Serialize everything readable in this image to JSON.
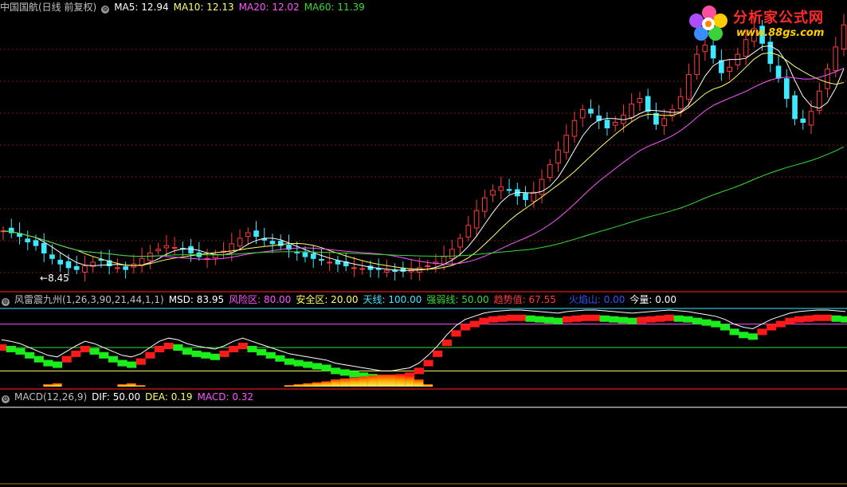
{
  "colors": {
    "bg": "#000000",
    "up": "#ff3b3b",
    "down": "#3ee8ff",
    "ma5": "#ffffff",
    "ma10": "#ffff66",
    "ma20": "#ff55ff",
    "ma60": "#33dd33",
    "grid": "#7a1a1a"
  },
  "main": {
    "title": "中国国航(日线 前复权)",
    "ma5": "MA5: 12.94",
    "ma10": "MA10: 12.13",
    "ma20": "MA20: 12.02",
    "ma60": "MA60: 11.39",
    "low_label": "8.45"
  },
  "ind": {
    "title": "风雷震九州(1,26,3,90,21,44,1,1)",
    "msd": "MSD: 83.95",
    "risk": "风险区: 80.00",
    "safe": "安全区: 20.00",
    "sky": "天线: 100.00",
    "strong": "强弱线: 50.00",
    "trend": "趋势值: 67.55",
    "volcano": "火焰山: 0.00",
    "today": "今量: 0.00"
  },
  "macd": {
    "title": "MACD(12,26,9)",
    "dif": "DIF: 50.00",
    "dea": "DEA: 0.19",
    "macd": "MACD: 0.32"
  },
  "logo": {
    "text": "分析家公式网",
    "url": "www.88gs.com"
  },
  "price_series": {
    "close": [
      11.0,
      10.9,
      10.7,
      10.4,
      10.2,
      9.8,
      9.5,
      9.2,
      9.0,
      8.9,
      9.1,
      9.3,
      9.4,
      9.1,
      9.0,
      8.9,
      9.2,
      9.5,
      9.8,
      10.0,
      10.2,
      10.1,
      10.0,
      9.8,
      9.6,
      9.5,
      9.7,
      9.9,
      10.3,
      10.6,
      10.9,
      10.7,
      10.5,
      10.3,
      10.2,
      10.0,
      9.8,
      9.6,
      9.5,
      9.4,
      9.3,
      9.2,
      9.1,
      9.0,
      8.95,
      8.9,
      8.9,
      8.85,
      8.8,
      8.8,
      8.9,
      9.0,
      9.1,
      9.3,
      9.6,
      10.0,
      10.6,
      11.3,
      12.1,
      12.8,
      13.2,
      13.4,
      13.2,
      12.9,
      12.7,
      13.1,
      13.8,
      14.6,
      15.4,
      16.2,
      17.0,
      17.6,
      17.4,
      17.0,
      16.6,
      16.9,
      17.3,
      17.9,
      18.2,
      17.5,
      16.8,
      17.1,
      17.6,
      18.3,
      19.5,
      20.6,
      21.1,
      20.4,
      19.6,
      19.9,
      20.6,
      21.4,
      22.0,
      21.2,
      20.1,
      19.3,
      18.2,
      17.1,
      16.9,
      17.5,
      18.6,
      19.8,
      21.0,
      22.2
    ]
  },
  "ind_series": {
    "msd": [
      60,
      58,
      55,
      50,
      45,
      40,
      38,
      45,
      52,
      58,
      55,
      50,
      45,
      40,
      38,
      42,
      50,
      58,
      62,
      60,
      55,
      52,
      50,
      48,
      52,
      58,
      62,
      58,
      54,
      50,
      46,
      42,
      40,
      38,
      36,
      34,
      30,
      28,
      26,
      24,
      22,
      20,
      20,
      22,
      24,
      30,
      40,
      52,
      66,
      78,
      86,
      90,
      94,
      96,
      97,
      98,
      98,
      97,
      96,
      95,
      94,
      96,
      97,
      98,
      98,
      97,
      96,
      95,
      94,
      95,
      96,
      97,
      98,
      97,
      96,
      94,
      92,
      90,
      86,
      80,
      76,
      74,
      80,
      86,
      90,
      94,
      96,
      97,
      98,
      98,
      97,
      96
    ]
  }
}
